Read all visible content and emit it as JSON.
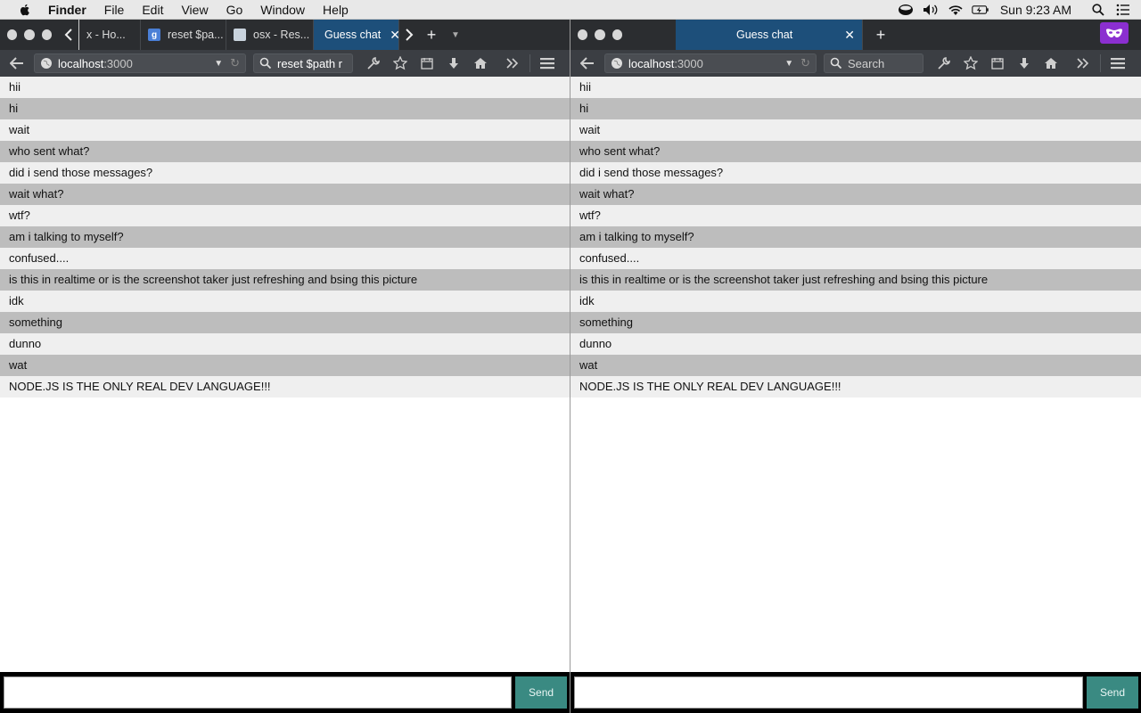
{
  "menubar": {
    "apple_icon": "apple-icon",
    "items": [
      "Finder",
      "File",
      "Edit",
      "View",
      "Go",
      "Window",
      "Help"
    ],
    "clock": "Sun 9:23 AM",
    "status_icons": [
      "coffee-icon",
      "volume-icon",
      "wifi-icon",
      "battery-icon",
      "search-icon",
      "list-icon"
    ]
  },
  "left_window": {
    "tabs": [
      {
        "label": "x - Ho...",
        "favicon": "stackexchange-icon"
      },
      {
        "label": "reset $pa...",
        "favicon": "google-icon"
      },
      {
        "label": "osx - Res...",
        "favicon": "stackexchange-icon"
      },
      {
        "label": "Guess chat",
        "active": true
      }
    ],
    "url_host": "localhost",
    "url_port": ":3000",
    "search_value": "reset $path r"
  },
  "right_window": {
    "tabs": [
      {
        "label": "Guess chat",
        "active": true
      }
    ],
    "url_host": "localhost",
    "url_port": ":3000",
    "search_placeholder": "Search",
    "profile_icon": "private-mask-icon"
  },
  "chat": {
    "messages": [
      "hii",
      "hi",
      "wait",
      "who sent what?",
      "did i send those messages?",
      "wait what?",
      "wtf?",
      "am i talking to myself?",
      "confused....",
      "is this in realtime or is the screenshot taker just refreshing and bsing this picture",
      "idk",
      "something",
      "dunno",
      "wat",
      "NODE.JS IS THE ONLY REAL DEV LANGUAGE!!!"
    ],
    "input_value": "",
    "send_label": "Send"
  },
  "colors": {
    "tab_active": "#1d4f7a",
    "send_button": "#3a8a82",
    "row_light": "#efefef",
    "row_dark": "#bdbdbd"
  }
}
